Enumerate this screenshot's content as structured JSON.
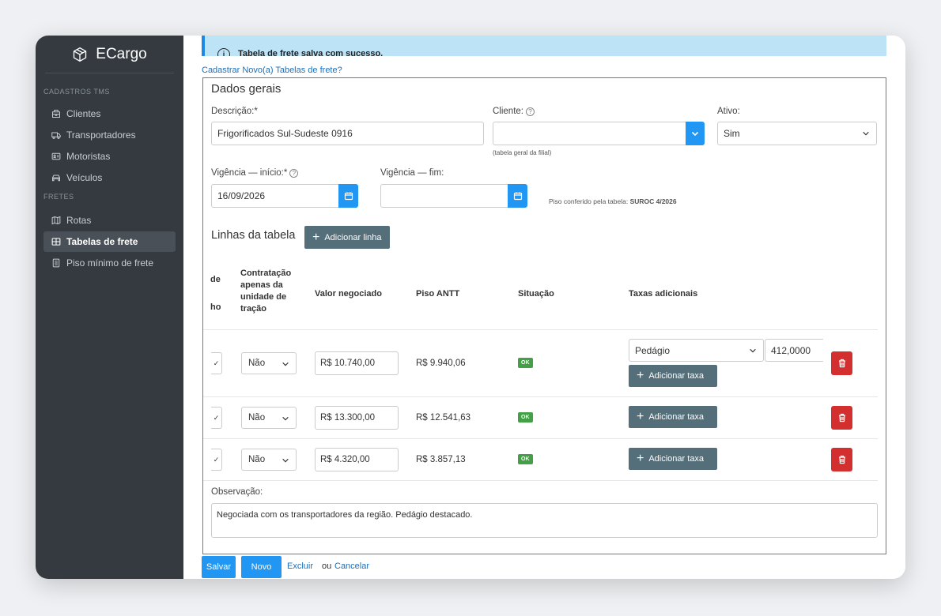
{
  "app": {
    "brand": "ECargo"
  },
  "sidebar": {
    "section1": "CADASTROS TMS",
    "items1": [
      {
        "label": "Clientes",
        "icon": "building-icon"
      },
      {
        "label": "Transportadores",
        "icon": "truck-icon"
      },
      {
        "label": "Motoristas",
        "icon": "id-card-icon"
      },
      {
        "label": "Veículos",
        "icon": "car-icon"
      }
    ],
    "section2": "FRETES",
    "items2": [
      {
        "label": "Rotas",
        "icon": "map-icon"
      },
      {
        "label": "Tabelas de frete",
        "icon": "table-icon",
        "active": true
      },
      {
        "label": "Piso mínimo de frete",
        "icon": "document-icon"
      }
    ]
  },
  "alert": {
    "message": "Tabela de frete salva com sucesso."
  },
  "new_link": "Cadastrar Novo(a) Tabelas de frete?",
  "form": {
    "title": "Dados gerais",
    "descricao_label": "Descrição:*",
    "descricao_value": "Frigorificados Sul-Sudeste 0916",
    "cliente_label": "Cliente:",
    "cliente_value": "",
    "cliente_note": "(tabela geral da filial)",
    "ativo_label": "Ativo:",
    "ativo_value": "Sim",
    "vig_inicio_label": "Vigência — início:*",
    "vig_inicio_value": "16/09/2026",
    "vig_fim_label": "Vigência — fim:",
    "vig_fim_value": "",
    "piso_note_prefix": "Piso conferido pela tabela:",
    "piso_note_value": "SUROC 4/2026"
  },
  "lines": {
    "title": "Linhas da tabela",
    "add_line_label": "Adicionar linha",
    "headers": {
      "col_cut_top": "de",
      "col_cut_bottom": "ho",
      "contratacao": "Contratação apenas da unidade de tração",
      "valor": "Valor negociado",
      "piso": "Piso ANTT",
      "situacao": "Situação",
      "taxas": "Taxas adicionais"
    },
    "rows": [
      {
        "check": "✓",
        "contratacao": "Não",
        "valor": "R$ 10.740,00",
        "piso": "R$ 9.940,06",
        "situacao": "OK",
        "taxa_tipo": "Pedágio",
        "taxa_valor": "412,0000",
        "add_taxa": "Adicionar taxa"
      },
      {
        "check": "✓",
        "contratacao": "Não",
        "valor": "R$ 13.300,00",
        "piso": "R$ 12.541,63",
        "situacao": "OK",
        "add_taxa": "Adicionar taxa"
      },
      {
        "check": "✓",
        "contratacao": "Não",
        "valor": "R$ 4.320,00",
        "piso": "R$ 3.857,13",
        "situacao": "OK",
        "add_taxa": "Adicionar taxa"
      }
    ]
  },
  "observacao": {
    "label": "Observação:",
    "value": "Negociada com os transportadores da região. Pedágio destacado."
  },
  "footer": {
    "save": "Salvar",
    "new": "Novo",
    "delete": "Excluir",
    "or": "ou",
    "cancel": "Cancelar"
  },
  "colors": {
    "sidebar": "#343a40",
    "primary": "#2196f3",
    "dark_button": "#546e7a",
    "danger": "#d32f2f",
    "success": "#43a047",
    "alert_bg": "#bde3f7"
  }
}
